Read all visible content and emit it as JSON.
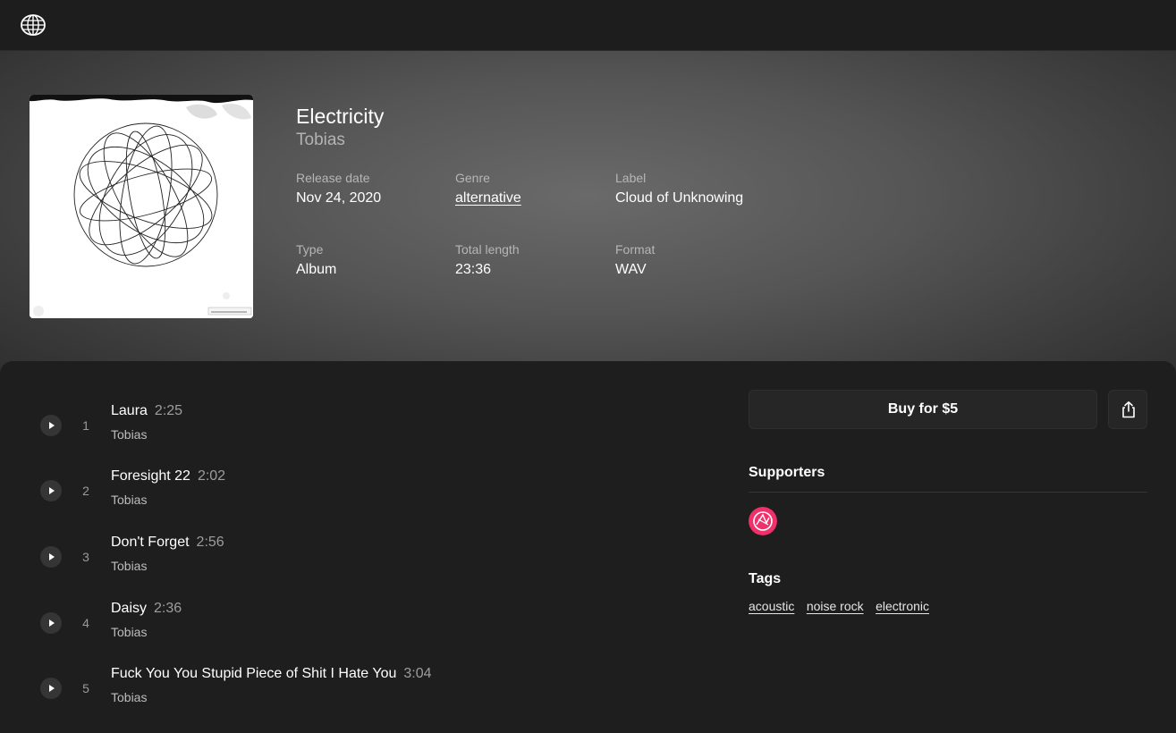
{
  "app": {
    "logo": "globe-logo-icon"
  },
  "album": {
    "title": "Electricity",
    "artist": "Tobias",
    "cover": "album-cover-drawing"
  },
  "meta": [
    {
      "label": "Release date",
      "value": "Nov 24, 2020"
    },
    {
      "label": "Genre",
      "value": "alternative"
    },
    {
      "label": "Label",
      "value": "Cloud of Unknowing"
    },
    {
      "label": "Type",
      "value": "Album"
    },
    {
      "label": "Total length",
      "value": "23:36"
    },
    {
      "label": "Format",
      "value": "WAV"
    }
  ],
  "tracks": [
    {
      "number": "1",
      "title": "Laura",
      "duration": "2:25",
      "artist": "Tobias"
    },
    {
      "number": "2",
      "title": "Foresight 22",
      "duration": "2:02",
      "artist": "Tobias"
    },
    {
      "number": "3",
      "title": "Don't Forget",
      "duration": "2:56",
      "artist": "Tobias"
    },
    {
      "number": "4",
      "title": "Daisy",
      "duration": "2:36",
      "artist": "Tobias"
    },
    {
      "number": "5",
      "title": "Fuck You You Stupid Piece of Shit I Hate You",
      "duration": "3:04",
      "artist": "Tobias"
    }
  ],
  "actions": {
    "buy_label": "Buy for $5",
    "share_icon": "share-icon",
    "play_icon": "play-icon"
  },
  "supporters": {
    "heading": "Supporters",
    "avatar_color": "#f0306b"
  },
  "tags": {
    "heading": "Tags",
    "items": [
      "acoustic",
      "noise rock",
      "electronic"
    ]
  }
}
